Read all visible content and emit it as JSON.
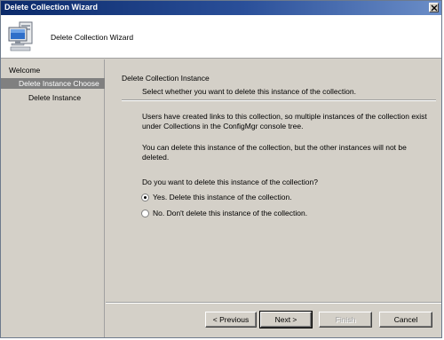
{
  "window": {
    "title": "Delete Collection Wizard"
  },
  "header": {
    "title": "Delete Collection Wizard",
    "icon": "computer-icon"
  },
  "sidebar": {
    "items": [
      {
        "label": "Welcome"
      },
      {
        "label": "Delete Instance Choose",
        "selected": true
      },
      {
        "label": "Delete Instance"
      }
    ]
  },
  "main": {
    "section_title": "Delete Collection Instance",
    "section_subtitle": "Select whether you want to delete this instance of the collection.",
    "message1": "Users have created links to this collection, so multiple instances of the collection exist under Collections in the ConfigMgr console tree.",
    "message2": "You can delete this instance of the collection, but the other instances will not be deleted.",
    "question": "Do you want to delete this instance of the collection?",
    "options": [
      {
        "label": "Yes. Delete this instance of the collection.",
        "selected": true
      },
      {
        "label": "No. Don't delete this instance of the collection.",
        "selected": false
      }
    ]
  },
  "buttons": {
    "previous": "< Previous",
    "next": "Next >",
    "finish": "Finish",
    "cancel": "Cancel"
  }
}
